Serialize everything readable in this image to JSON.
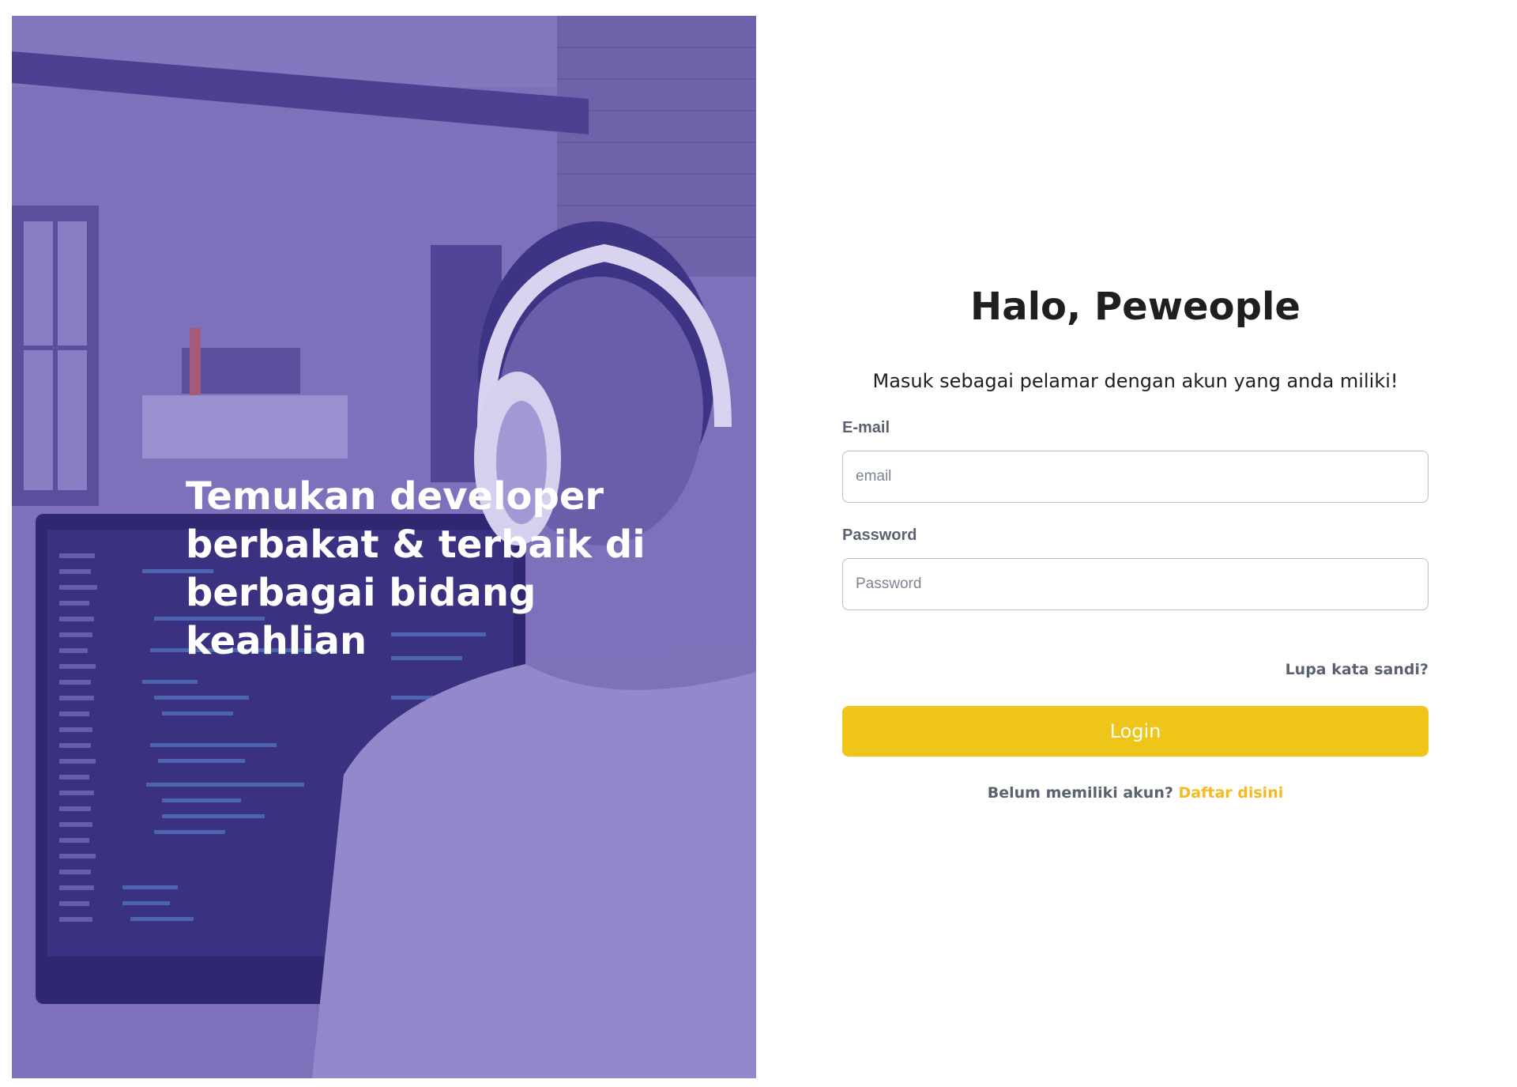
{
  "hero": {
    "tagline_line1": "Temukan developer",
    "tagline_line2": "berbakat & terbaik di",
    "tagline_line3": "berbagai bidang keahlian",
    "overlay_color": "#7a6cb8"
  },
  "form": {
    "title": "Halo, Peweople",
    "subtitle": "Masuk sebagai pelamar dengan akun yang anda miliki!",
    "email_label": "E-mail",
    "email_placeholder": "email",
    "email_value": "",
    "password_label": "Password",
    "password_placeholder": "Password",
    "password_value": "",
    "forgot_link": "Lupa kata sandi?",
    "login_button": "Login",
    "register_prompt": "Belum memiliki akun?",
    "register_link": "Daftar disini"
  },
  "colors": {
    "accent": "#f0c51a",
    "link": "#f5b921",
    "label": "#5a6270"
  }
}
